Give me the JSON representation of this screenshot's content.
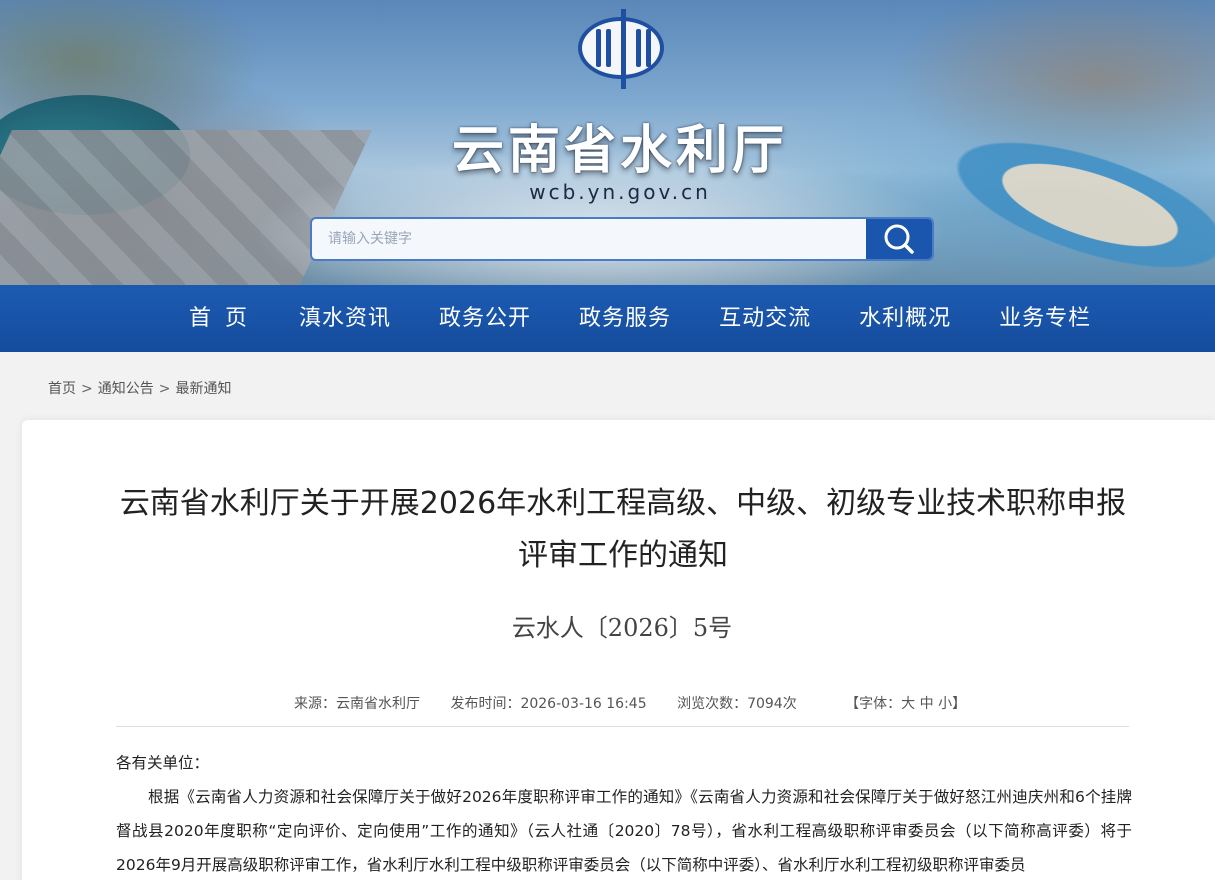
{
  "header": {
    "site_title": "云南省水利厅",
    "site_domain": "wcb.yn.gov.cn",
    "search_placeholder": "请输入关键字",
    "colors": {
      "nav_bg": "#1c5bb3",
      "accent": "#1a56ad"
    }
  },
  "nav": {
    "items": [
      {
        "label": "首页"
      },
      {
        "label": "滇水资讯"
      },
      {
        "label": "政务公开"
      },
      {
        "label": "政务服务"
      },
      {
        "label": "互动交流"
      },
      {
        "label": "水利概况"
      },
      {
        "label": "业务专栏"
      }
    ]
  },
  "breadcrumb": {
    "items": [
      "首页",
      "通知公告",
      "最新通知"
    ],
    "separator": ">"
  },
  "article": {
    "title": "云南省水利厅关于开展2026年水利工程高级、中级、初级专业技术职称申报评审工作的通知",
    "doc_number": "云水人〔2026〕5号",
    "source": "来源：云南省水利厅",
    "publish_time": "发布时间：2026-03-16 16:45",
    "views": "浏览次数：7094次",
    "font_size_label_open": "【字体：",
    "font_large": "大",
    "font_medium": "中",
    "font_small": "小",
    "font_size_label_close": "】",
    "salutation": "各有关单位：",
    "paragraph": "根据《云南省人力资源和社会保障厅关于做好2026年度职称评审工作的通知》《云南省人力资源和社会保障厅关于做好怒江州迪庆州和6个挂牌督战县2020年度职称“定向评价、定向使用”工作的通知》（云人社通〔2020〕78号），省水利工程高级职称评审委员会（以下简称高评委）将于2026年9月开展高级职称评审工作，省水利厅水利工程中级职称评审委员会（以下简称中评委）、省水利厅水利工程初级职称评审委员"
  }
}
